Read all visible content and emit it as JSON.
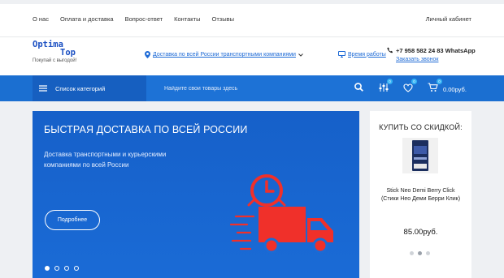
{
  "top_nav": {
    "links": [
      "О нас",
      "Оплата и доставка",
      "Вопрос-ответ",
      "Контакты",
      "Отзывы"
    ],
    "cabinet": "Личный кабинет"
  },
  "header": {
    "logo_line1": "Optima",
    "logo_line2": "Top",
    "logo_tagline": "Покупай с выгодой!",
    "delivery": "Доставка по всей России транспортными компаниями",
    "work_time": "Время работы",
    "phone": "+7 958 582 24 83 WhatsApp",
    "call_request": "Заказать звонок"
  },
  "navbar": {
    "categories_label": "Список категорий",
    "search_placeholder": "Найдите свои товары здесь",
    "compare_count": "0",
    "favorites_count": "0",
    "cart_count": "0",
    "cart_total": "0.00руб."
  },
  "banner": {
    "title": "БЫСТРАЯ ДОСТАВКА ПО ВСЕЙ РОССИИ",
    "description": "Доставка транспортными и курьерскими компаниями по всей России",
    "more_button": "Подробнее",
    "slides": 4,
    "active_slide": 1
  },
  "sale": {
    "title": "КУПИТЬ СО СКИДКОЙ:",
    "product_name": "Stick Neo Demi Berry Click (Стики Нео Деми Берри Клик)",
    "price": "85.00руб.",
    "slides": 3,
    "active_slide": 2
  },
  "colors": {
    "brand_blue": "#1b6fd1",
    "dark_blue": "#165fc0",
    "truck_red": "#f0302a",
    "badge": "#36b4f5"
  }
}
